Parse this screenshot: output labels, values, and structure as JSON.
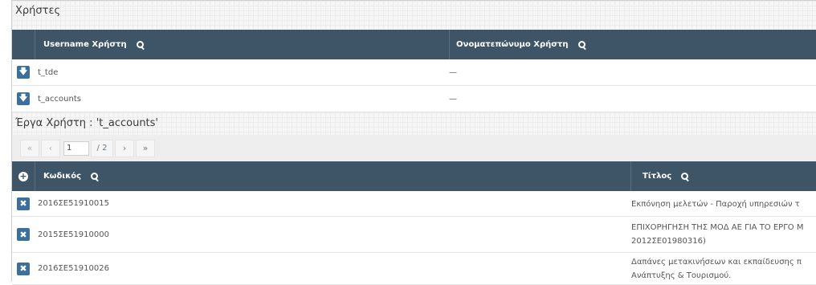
{
  "users_panel": {
    "title": "Χρήστες",
    "columns": [
      "Username Χρήστη",
      "Ονοματεπώνυμο Χρήστη"
    ],
    "rows": [
      {
        "username": "t_tde",
        "fullname": "—"
      },
      {
        "username": "t_accounts",
        "fullname": "—"
      }
    ]
  },
  "projects_panel": {
    "title": "Έργα Χρήστη : 't_accounts'",
    "pager": {
      "first": "«",
      "prev": "‹",
      "page_value": "1",
      "total": "/ 2",
      "next": "›",
      "last": "»"
    },
    "columns": [
      "Κωδικός",
      "Τίτλος"
    ],
    "rows": [
      {
        "code": "2016ΣΕ51910015",
        "title_lines": [
          "Εκπόνηση μελετών - Παροχή υπηρεσιών τ"
        ]
      },
      {
        "code": "2015ΣΕ51910000",
        "title_lines": [
          "ΕΠΙΧΟΡΗΓΗΣΗ ΤΗΣ ΜΟΔ ΑΕ ΓΙΑ ΤΟ ΕΡΓΟ Μ",
          "2012ΣΕ01980316)"
        ]
      },
      {
        "code": "2016ΣΕ51910026",
        "title_lines": [
          "Δαπάνες μετακινήσεων και εκπαίδευσης π",
          "Ανάπτυξης & Τουρισμού."
        ]
      }
    ]
  },
  "icons": {
    "row_expand": "arrow-down-icon",
    "row_remove": "close-icon",
    "header_add": "plus-circle-icon",
    "search": "search-icon"
  },
  "colors": {
    "header_bg": "#3d5566",
    "button_bg": "#3b6f9c"
  }
}
